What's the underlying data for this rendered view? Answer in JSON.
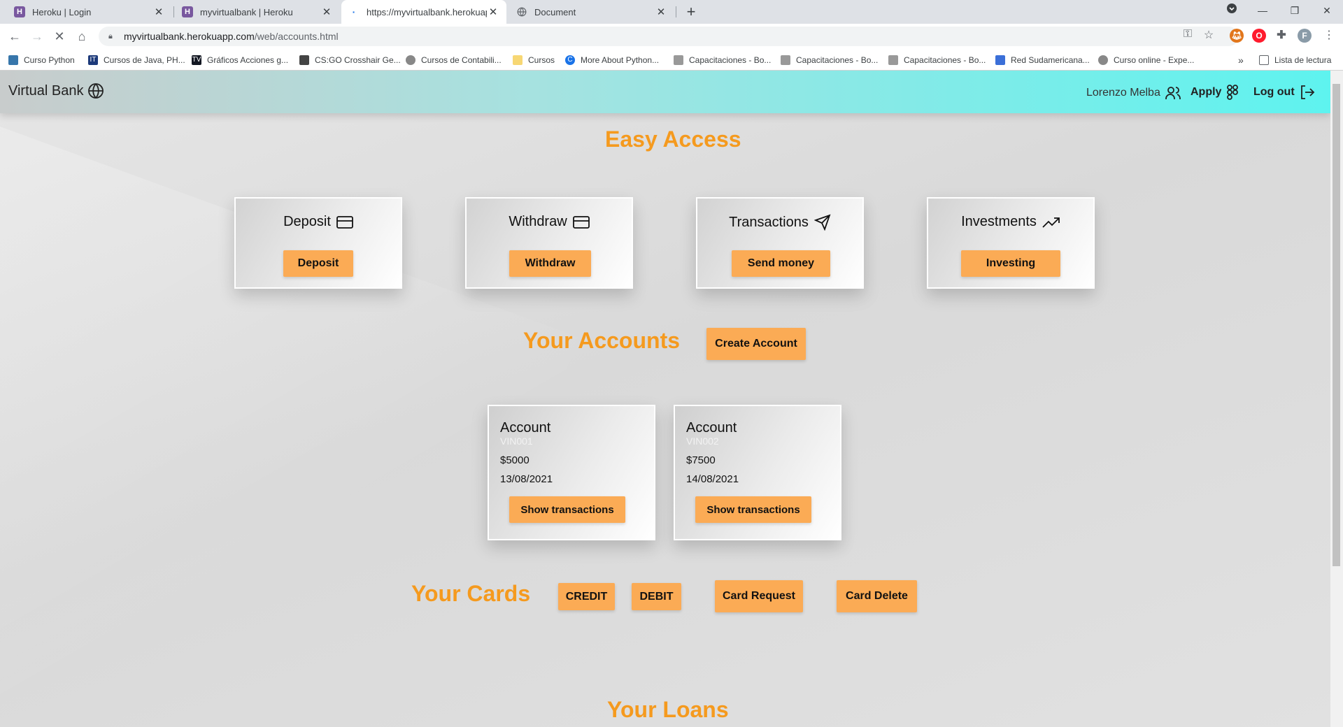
{
  "browser": {
    "tabs": [
      {
        "title": "Heroku | Login",
        "favicon": "heroku-icon"
      },
      {
        "title": "myvirtualbank | Heroku",
        "favicon": "heroku-icon"
      },
      {
        "title": "https://myvirtualbank.herokuapp",
        "favicon": "loading-icon"
      },
      {
        "title": "Document",
        "favicon": "globe-icon"
      }
    ],
    "url_host": "myvirtualbank.herokuapp.com",
    "url_path": "/web/accounts.html",
    "bookmarks": [
      "Curso Python",
      "Cursos de Java, PH...",
      "Gráficos Acciones g...",
      "CS:GO Crosshair Ge...",
      "Cursos de Contabili...",
      "Cursos",
      "More About Python...",
      "Capacitaciones - Bo...",
      "Capacitaciones - Bo...",
      "Capacitaciones - Bo...",
      "Red Sudamericana...",
      "Curso online - Expe..."
    ],
    "reading_list": "Lista de lectura",
    "profile_initial": "F"
  },
  "navbar": {
    "brand": "Virtual Bank",
    "user": "Lorenzo Melba",
    "apply": "Apply",
    "logout": "Log out"
  },
  "easy_access": {
    "title": "Easy Access",
    "cards": [
      {
        "title": "Deposit",
        "button": "Deposit",
        "icon": "credit-card-icon"
      },
      {
        "title": "Withdraw",
        "button": "Withdraw",
        "icon": "credit-card-icon"
      },
      {
        "title": "Transactions",
        "button": "Send money",
        "icon": "send-icon"
      },
      {
        "title": "Investments",
        "button": "Investing",
        "icon": "trending-up-icon"
      }
    ]
  },
  "accounts": {
    "title": "Your Accounts",
    "create_button": "Create Account",
    "items": [
      {
        "title": "Account",
        "number": "VIN001",
        "balance": "$5000",
        "date": "13/08/2021",
        "button": "Show transactions"
      },
      {
        "title": "Account",
        "number": "VIN002",
        "balance": "$7500",
        "date": "14/08/2021",
        "button": "Show transactions"
      }
    ]
  },
  "cards": {
    "title": "Your Cards",
    "credit": "CREDIT",
    "debit": "DEBIT",
    "request": "Card Request",
    "delete": "Card Delete"
  },
  "loans": {
    "title": "Your Loans"
  },
  "colors": {
    "accent": "#f59a1e",
    "button": "#fbab55",
    "navbar_end": "#5ef3ef"
  }
}
